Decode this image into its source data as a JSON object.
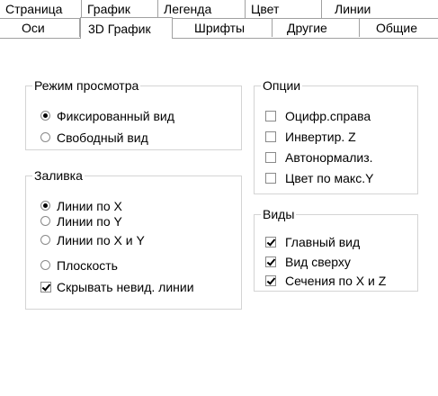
{
  "tabs": {
    "row1": [
      "Страница",
      "График",
      "Легенда",
      "Цвет",
      "Линии"
    ],
    "row2": [
      "Оси",
      "3D График",
      "Шрифты",
      "Другие",
      "Общие"
    ],
    "selected": "3D График"
  },
  "view_mode": {
    "title": "Режим просмотра",
    "options": [
      {
        "label": "Фиксированный вид",
        "checked": true
      },
      {
        "label": "Свободный вид",
        "checked": false
      }
    ]
  },
  "fill": {
    "title": "Заливка",
    "options": [
      {
        "label": "Линии по X",
        "checked": true
      },
      {
        "label": "Линии по Y",
        "checked": false
      },
      {
        "label": "Линии по X и Y",
        "checked": false
      },
      {
        "label": "Плоскость",
        "checked": false
      }
    ],
    "hide_lines": {
      "label": "Скрывать невид. линии",
      "checked": true
    }
  },
  "options": {
    "title": "Опции",
    "items": [
      {
        "label": "Оцифр.справа",
        "checked": false
      },
      {
        "label": "Инвертир. Z",
        "checked": false
      },
      {
        "label": "Автонормализ.",
        "checked": false
      },
      {
        "label": "Цвет по макс.Y",
        "checked": false
      }
    ]
  },
  "views": {
    "title": "Виды",
    "items": [
      {
        "label": "Главный вид",
        "checked": true
      },
      {
        "label": "Вид сверху",
        "checked": true
      },
      {
        "label": "Сечения по X и Z",
        "checked": true
      }
    ]
  }
}
